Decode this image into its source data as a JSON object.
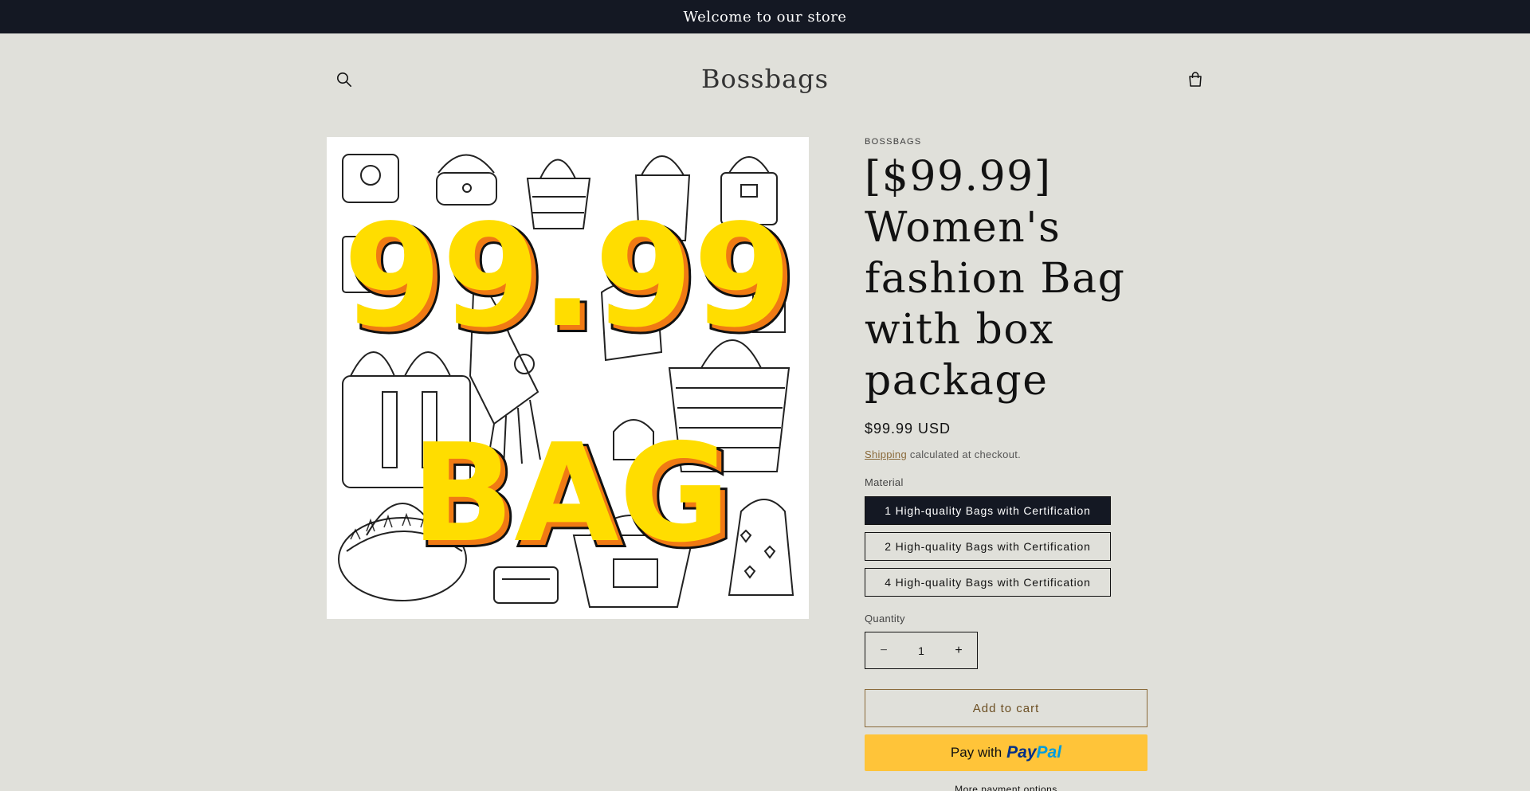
{
  "announcement": {
    "text": "Welcome to our store"
  },
  "header": {
    "logo": "Bossbags",
    "search_icon": "search-icon",
    "cart_icon": "cart-icon"
  },
  "media": {
    "image_text_top": "99.99",
    "image_text_bottom": "BAG"
  },
  "product": {
    "vendor": "BOSSBAGS",
    "title": "[$99.99] Women's fashion Bag with box package",
    "price": "$99.99 USD",
    "shipping_link": "Shipping",
    "shipping_note": " calculated at checkout.",
    "variant_label": "Material",
    "variants": [
      {
        "label": "1 High-quality Bags with Certification",
        "selected": true
      },
      {
        "label": "2 High-quality Bags with Certification",
        "selected": false
      },
      {
        "label": "4 High-quality Bags with Certification",
        "selected": false
      }
    ],
    "quantity_label": "Quantity",
    "quantity": "1",
    "minus_glyph": "−",
    "plus_glyph": "+",
    "add_to_cart": "Add to cart",
    "paypal_prefix": "Pay with",
    "paypal_brand_1": "Pay",
    "paypal_brand_2": "Pal",
    "more_payment": "More payment options"
  },
  "colors": {
    "background": "#e0e0da",
    "announcement_bg": "#141823",
    "selected_pill": "#141823",
    "paypal_yellow": "#ffc439",
    "accent_brown": "#8a6a3a",
    "image_text_yellow": "#ffdd00",
    "image_text_orange": "#f07a14"
  }
}
